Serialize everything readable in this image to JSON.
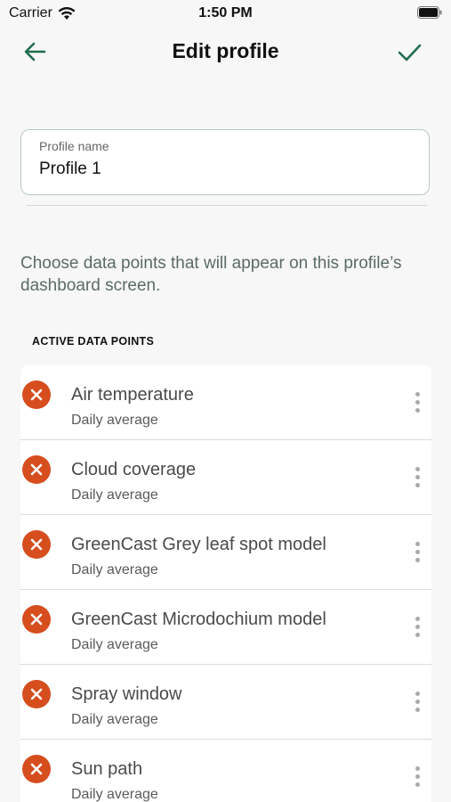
{
  "status_bar": {
    "carrier": "Carrier",
    "time": "1:50 PM",
    "wifi_icon": "wifi-icon",
    "battery_icon": "battery-icon"
  },
  "nav": {
    "title": "Edit profile",
    "back_icon": "arrow-left-icon",
    "done_icon": "checkmark-icon",
    "accent_color": "#1e6e4c"
  },
  "profile_name": {
    "label": "Profile name",
    "value": "Profile 1"
  },
  "description": "Choose data points that will appear on this profile’s dashboard screen.",
  "section": {
    "title": "ACTIVE DATA POINTS"
  },
  "data_points": [
    {
      "title": "Air temperature",
      "subtitle": "Daily average"
    },
    {
      "title": "Cloud coverage",
      "subtitle": "Daily average"
    },
    {
      "title": "GreenCast Grey leaf spot model",
      "subtitle": "Daily average"
    },
    {
      "title": "GreenCast Microdochium model",
      "subtitle": "Daily average"
    },
    {
      "title": "Spray window",
      "subtitle": "Daily average"
    },
    {
      "title": "Sun path",
      "subtitle": "Daily average"
    }
  ],
  "colors": {
    "remove": "#d64d1e",
    "background": "#f7f7f7"
  }
}
